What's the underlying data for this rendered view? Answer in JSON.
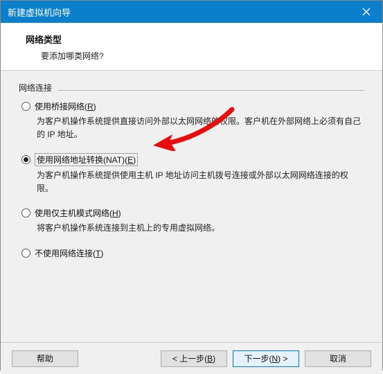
{
  "window": {
    "title": "新建虚拟机向导"
  },
  "header": {
    "title": "网络类型",
    "subtitle": "要添加哪类网络?"
  },
  "section": {
    "label": "网络连接"
  },
  "options": {
    "bridged": {
      "label_pre": "使用桥接网络(",
      "accel": "R",
      "label_post": ")",
      "desc": "为客户机操作系统提供直接访问外部以太网网络的权限。客户机在外部网络上必须有自己的 IP 地址。"
    },
    "nat": {
      "label_pre": "使用网络地址转换(NAT)(",
      "accel": "E",
      "label_post": ")",
      "desc": "为客户机操作系统提供使用主机 IP 地址访问主机拨号连接或外部以太网网络连接的权限。"
    },
    "hostonly": {
      "label_pre": "使用仅主机模式网络(",
      "accel": "H",
      "label_post": ")",
      "desc": "将客户机操作系统连接到主机上的专用虚拟网络。"
    },
    "none": {
      "label_pre": "不使用网络连接(",
      "accel": "T",
      "label_post": ")"
    }
  },
  "footer": {
    "help": "帮助",
    "back_pre": "< 上一步(",
    "back_accel": "B",
    "back_post": ")",
    "next_pre": "下一步(",
    "next_accel": "N",
    "next_post": ") >",
    "cancel": "取消"
  },
  "annotation": {
    "arrow_color": "#e80c0c"
  }
}
